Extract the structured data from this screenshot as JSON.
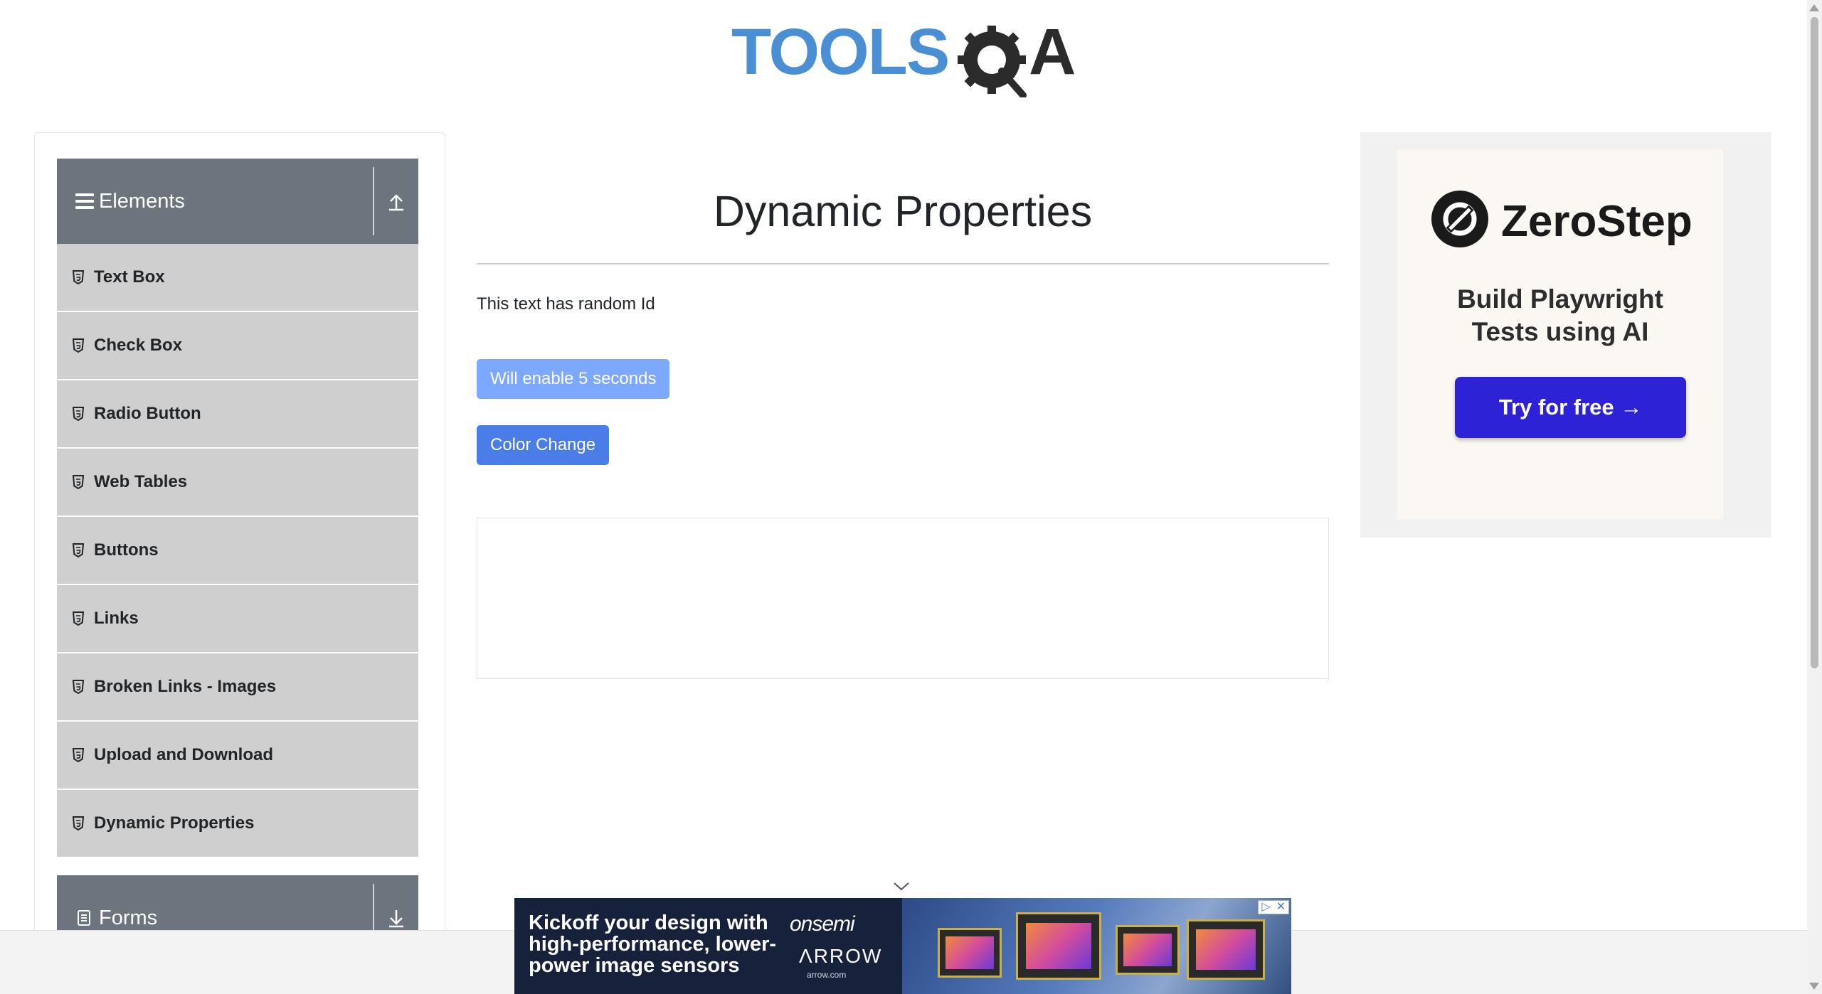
{
  "header": {
    "logo_text": "TOOLSQA"
  },
  "sidebar": {
    "groups": [
      {
        "title": "Elements",
        "expanded": true
      },
      {
        "title": "Forms",
        "expanded": false
      }
    ],
    "items": [
      {
        "label": "Text Box"
      },
      {
        "label": "Check Box"
      },
      {
        "label": "Radio Button"
      },
      {
        "label": "Web Tables"
      },
      {
        "label": "Buttons"
      },
      {
        "label": "Links"
      },
      {
        "label": "Broken Links - Images"
      },
      {
        "label": "Upload and Download"
      },
      {
        "label": "Dynamic Properties"
      }
    ]
  },
  "main": {
    "title": "Dynamic Properties",
    "random_text": "This text has random Id",
    "enable_button": "Will enable 5 seconds",
    "color_button": "Color Change"
  },
  "side_ad": {
    "brand": "ZeroStep",
    "tagline_line1": "Build Playwright",
    "tagline_line2": "Tests using AI",
    "cta": "Try for free →",
    "cta_color": "#2e22d6"
  },
  "bottom_ad": {
    "headline": "Kickoff your design with high-performance, lower-power image sensors",
    "brand1": "onsemi",
    "brand2": "ΛRROW",
    "brand2_sub": "arrow.com",
    "close_label_1": "▷",
    "close_label_2": "✕"
  },
  "colors": {
    "group_header_bg": "#6c757d",
    "menu_item_bg": "#cfcfcf",
    "button_primary": "#4a7de8",
    "button_disabled": "#7da8ff"
  }
}
